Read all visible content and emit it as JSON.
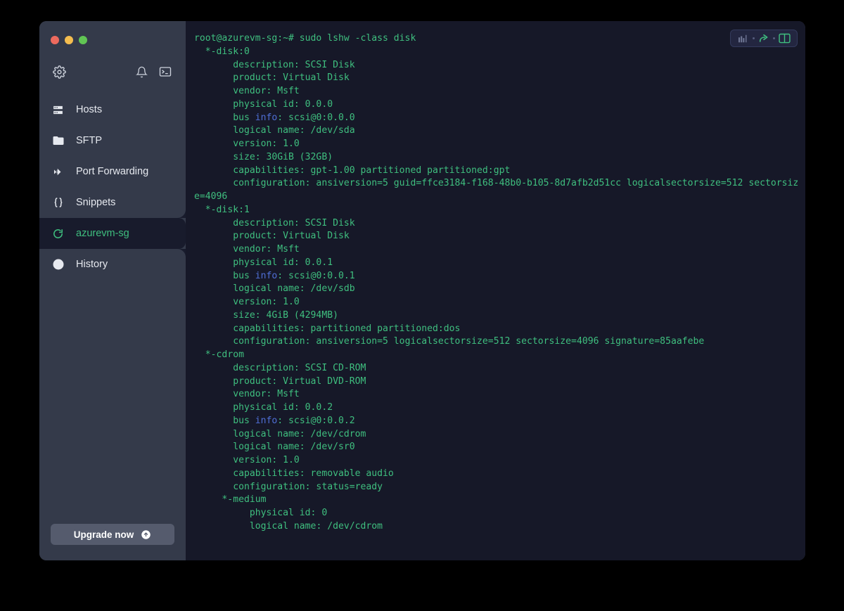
{
  "window": {
    "traffic_lights": {
      "close_color": "#ed6a5e",
      "minimize_color": "#f4bd4f",
      "maximize_color": "#61c554"
    }
  },
  "sidebar": {
    "toolbar": [
      {
        "name": "settings-icon",
        "label": "Settings"
      },
      {
        "name": "notifications-icon",
        "label": "Notifications"
      },
      {
        "name": "terminal-icon",
        "label": "New Terminal"
      }
    ],
    "items": [
      {
        "label": "Hosts",
        "icon": "server-icon",
        "active": false
      },
      {
        "label": "SFTP",
        "icon": "folder-icon",
        "active": false
      },
      {
        "label": "Port Forwarding",
        "icon": "arrows-right-icon",
        "active": false
      },
      {
        "label": "Snippets",
        "icon": "braces-icon",
        "active": false
      },
      {
        "label": "azurevm-sg",
        "icon": "session-active-icon",
        "active": true
      },
      {
        "label": "History",
        "icon": "clock-icon",
        "active": false
      }
    ],
    "upgrade_label": "Upgrade now",
    "upgrade_icon": "arrow-up-circle-icon",
    "active_color": "#3fbf7f"
  },
  "terminal": {
    "controls": [
      {
        "name": "signal-icon",
        "label": "Connection quality"
      },
      {
        "name": "share-icon",
        "label": "Share session"
      },
      {
        "name": "split-pane-icon",
        "label": "Split pane"
      }
    ],
    "accent_color": "#3fbf7f",
    "keyword_color": "#4f6fd6",
    "background_color": "#161828",
    "prompt": "root@azurevm-sg:~#",
    "command": "sudo lshw -class disk",
    "lines": [
      "root@azurevm-sg:~# sudo lshw -class disk",
      "  *-disk:0",
      "       description: SCSI Disk",
      "       product: Virtual Disk",
      "       vendor: Msft",
      "       physical id: 0.0.0",
      "       bus info: scsi@0:0.0.0",
      "       logical name: /dev/sda",
      "       version: 1.0",
      "       size: 30GiB (32GB)",
      "       capabilities: gpt-1.00 partitioned partitioned:gpt",
      "       configuration: ansiversion=5 guid=ffce3184-f168-48b0-b105-8d7afb2d51cc logicalsectorsize=512 sectorsize=4096",
      "  *-disk:1",
      "       description: SCSI Disk",
      "       product: Virtual Disk",
      "       vendor: Msft",
      "       physical id: 0.0.1",
      "       bus info: scsi@0:0.0.1",
      "       logical name: /dev/sdb",
      "       version: 1.0",
      "       size: 4GiB (4294MB)",
      "       capabilities: partitioned partitioned:dos",
      "       configuration: ansiversion=5 logicalsectorsize=512 sectorsize=4096 signature=85aafebe",
      "  *-cdrom",
      "       description: SCSI CD-ROM",
      "       product: Virtual DVD-ROM",
      "       vendor: Msft",
      "       physical id: 0.0.2",
      "       bus info: scsi@0:0.0.2",
      "       logical name: /dev/cdrom",
      "       logical name: /dev/sr0",
      "       version: 1.0",
      "       capabilities: removable audio",
      "       configuration: status=ready",
      "     *-medium",
      "          physical id: 0",
      "          logical name: /dev/cdrom"
    ]
  }
}
